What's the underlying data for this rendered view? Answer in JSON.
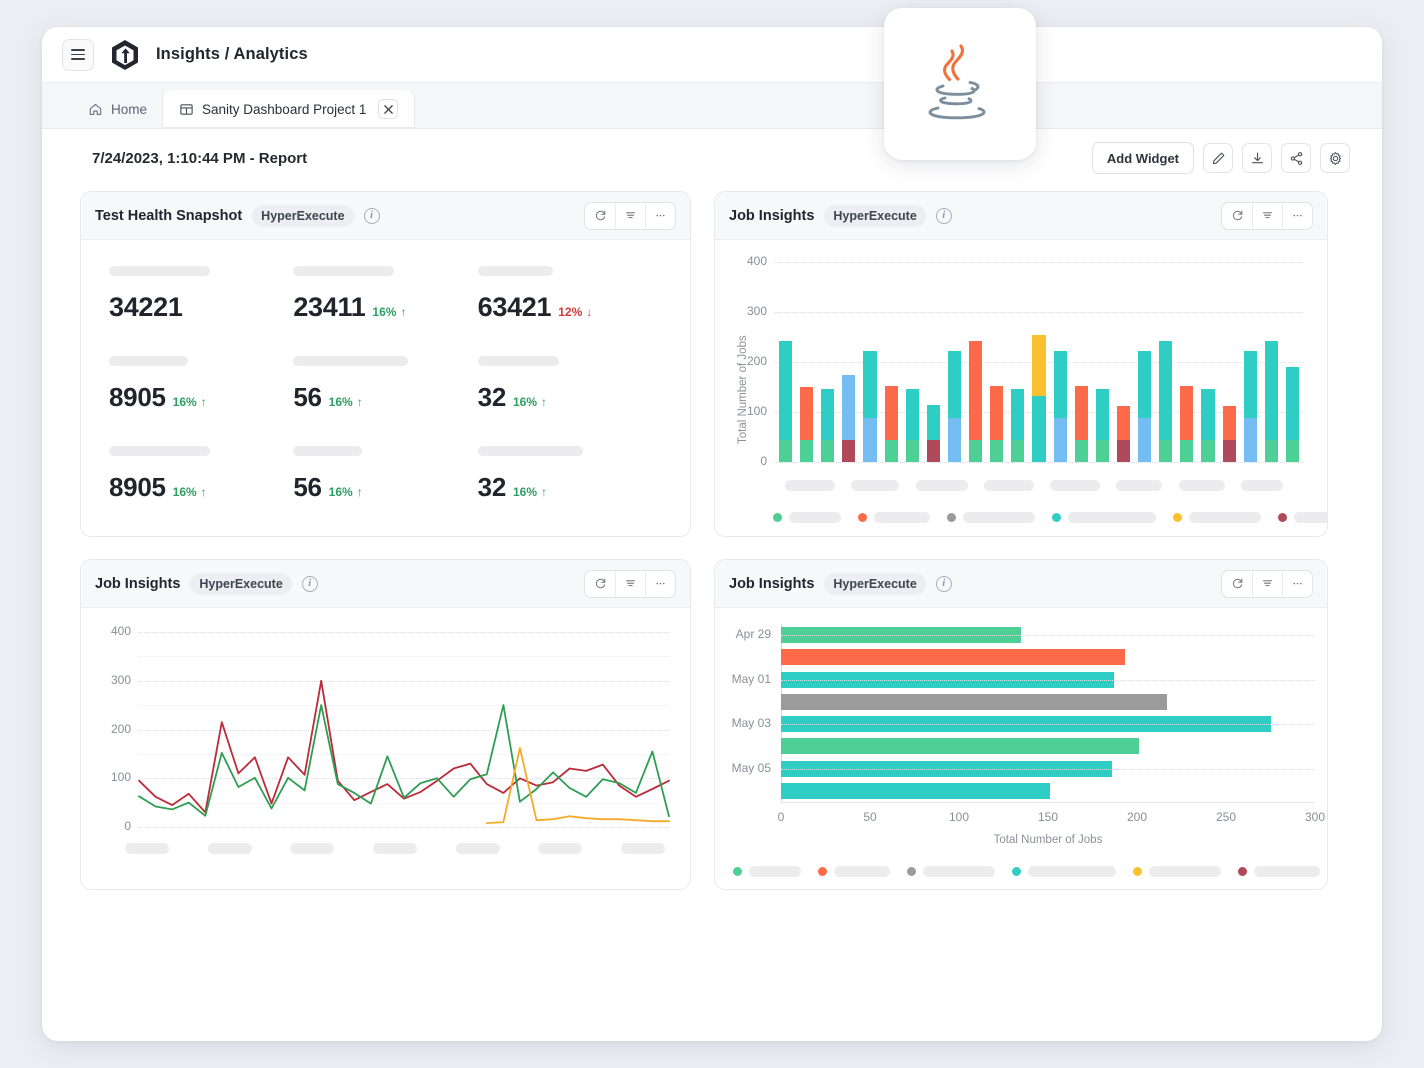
{
  "app": {
    "title": "Insights / Analytics",
    "menu_icon": "hamburger-icon",
    "logo_icon": "brand-hexagon-logo"
  },
  "tabs": [
    {
      "label": "Home",
      "icon": "home-icon",
      "active": false,
      "closable": false
    },
    {
      "label": "Sanity Dashboard Project 1",
      "icon": "dashboard-icon",
      "active": true,
      "closable": true
    }
  ],
  "report": {
    "title": "7/24/2023, 1:10:44 PM - Report",
    "toolbar": {
      "add_widget_label": "Add Widget",
      "edit_icon": "pencil-icon",
      "download_icon": "download-icon",
      "share_icon": "share-icon",
      "settings_icon": "gear-icon"
    }
  },
  "floating_icon": {
    "name": "java-logo",
    "label": "Java"
  },
  "card_actions": {
    "refresh_icon": "refresh-icon",
    "filter_icon": "filter-icon",
    "more_icon": "more-horizontal-icon"
  },
  "colors": {
    "teal": "#2ecec4",
    "green": "#4ecf95",
    "orange": "#fc6a4a",
    "blue": "#74bdf2",
    "maroon": "#b04a5a",
    "yellow": "#fbc02d",
    "gray": "#9b9b9b",
    "up": "#2e9e63",
    "down": "#d23b3b",
    "line_red": "#bc2b3a",
    "line_green": "#2e9e52",
    "line_amber": "#f5ab2a",
    "skeleton": "#ececee"
  },
  "cards": {
    "snapshot": {
      "title": "Test Health Snapshot",
      "badge": "HyperExecute",
      "info_icon": "info-icon",
      "rows": [
        [
          {
            "value": "34221",
            "delta": null,
            "dir": null
          },
          {
            "value": "23411",
            "delta": "16%",
            "dir": "up"
          },
          {
            "value": "63421",
            "delta": "12%",
            "dir": "down"
          }
        ],
        [
          {
            "value": "8905",
            "delta": "16%",
            "dir": "up"
          },
          {
            "value": "56",
            "delta": "16%",
            "dir": "up"
          },
          {
            "value": "32",
            "delta": "16%",
            "dir": "up"
          }
        ],
        [
          {
            "value": "8905",
            "delta": "16%",
            "dir": "up"
          },
          {
            "value": "56",
            "delta": "16%",
            "dir": "up"
          },
          {
            "value": "32",
            "delta": "16%",
            "dir": "up"
          }
        ]
      ]
    },
    "job_insights_bar": {
      "title": "Job Insights",
      "badge": "HyperExecute",
      "info_icon": "info-icon"
    },
    "job_insights_line": {
      "title": "Job Insights",
      "badge": "HyperExecute",
      "info_icon": "info-icon"
    },
    "job_insights_hbar": {
      "title": "Job Insights",
      "badge": "HyperExecute",
      "info_icon": "info-icon"
    }
  },
  "chart_data": [
    {
      "id": "stacked-bar",
      "type": "bar",
      "stacked": true,
      "title": "Job Insights",
      "xlabel": "",
      "ylabel": "Total Number of Jobs",
      "ylim": [
        0,
        400
      ],
      "yticks": [
        0,
        100,
        200,
        300,
        400
      ],
      "grid": true,
      "legend_position": "bottom",
      "legend": [
        {
          "color": "#4ecf95",
          "label": ""
        },
        {
          "color": "#fc6a4a",
          "label": ""
        },
        {
          "color": "#9b9b9b",
          "label": ""
        },
        {
          "color": "#2ecec4",
          "label": ""
        },
        {
          "color": "#fbc02d",
          "label": ""
        },
        {
          "color": "#b04a5a",
          "label": ""
        }
      ],
      "categories": [
        "",
        "",
        "",
        "",
        "",
        "",
        "",
        "",
        "",
        "",
        "",
        "",
        "",
        "",
        "",
        "",
        "",
        "",
        "",
        "",
        "",
        "",
        "",
        "",
        "",
        "",
        "",
        ""
      ],
      "bars": [
        {
          "segments": [
            {
              "color": "#4ecf95",
              "value": 44
            },
            {
              "color": "#2ecec4",
              "value": 198
            }
          ]
        },
        {
          "segments": [
            {
              "color": "#4ecf95",
              "value": 44
            },
            {
              "color": "#fc6a4a",
              "value": 107
            }
          ]
        },
        {
          "segments": [
            {
              "color": "#4ecf95",
              "value": 44
            },
            {
              "color": "#2ecec4",
              "value": 103
            }
          ]
        },
        {
          "segments": [
            {
              "color": "#b04a5a",
              "value": 44
            },
            {
              "color": "#74bdf2",
              "value": 130
            }
          ]
        },
        {
          "segments": [
            {
              "color": "#74bdf2",
              "value": 88
            },
            {
              "color": "#2ecec4",
              "value": 135
            }
          ]
        },
        {
          "segments": [
            {
              "color": "#4ecf95",
              "value": 44
            },
            {
              "color": "#fc6a4a",
              "value": 108
            }
          ]
        },
        {
          "segments": [
            {
              "color": "#4ecf95",
              "value": 44
            },
            {
              "color": "#2ecec4",
              "value": 103
            }
          ]
        },
        {
          "segments": [
            {
              "color": "#b04a5a",
              "value": 44
            },
            {
              "color": "#2ecec4",
              "value": 70
            }
          ]
        },
        {
          "segments": [
            {
              "color": "#74bdf2",
              "value": 88
            },
            {
              "color": "#2ecec4",
              "value": 135
            }
          ]
        },
        {
          "segments": [
            {
              "color": "#4ecf95",
              "value": 44
            },
            {
              "color": "#fc6a4a",
              "value": 199
            }
          ]
        },
        {
          "segments": [
            {
              "color": "#4ecf95",
              "value": 44
            },
            {
              "color": "#fc6a4a",
              "value": 108
            }
          ]
        },
        {
          "segments": [
            {
              "color": "#4ecf95",
              "value": 44
            },
            {
              "color": "#2ecec4",
              "value": 103
            }
          ]
        },
        {
          "segments": [
            {
              "color": "#2ecec4",
              "value": 133
            },
            {
              "color": "#fbc02d",
              "value": 122
            }
          ]
        },
        {
          "segments": [
            {
              "color": "#74bdf2",
              "value": 88
            },
            {
              "color": "#2ecec4",
              "value": 135
            }
          ]
        },
        {
          "segments": [
            {
              "color": "#4ecf95",
              "value": 44
            },
            {
              "color": "#fc6a4a",
              "value": 108
            }
          ]
        },
        {
          "segments": [
            {
              "color": "#4ecf95",
              "value": 44
            },
            {
              "color": "#2ecec4",
              "value": 103
            }
          ]
        },
        {
          "segments": [
            {
              "color": "#b04a5a",
              "value": 44
            },
            {
              "color": "#fc6a4a",
              "value": 69
            }
          ]
        },
        {
          "segments": [
            {
              "color": "#74bdf2",
              "value": 88
            },
            {
              "color": "#2ecec4",
              "value": 134
            }
          ]
        },
        {
          "segments": [
            {
              "color": "#4ecf95",
              "value": 44
            },
            {
              "color": "#2ecec4",
              "value": 199
            }
          ]
        },
        {
          "segments": [
            {
              "color": "#4ecf95",
              "value": 44
            },
            {
              "color": "#fc6a4a",
              "value": 109
            }
          ]
        },
        {
          "segments": [
            {
              "color": "#4ecf95",
              "value": 44
            },
            {
              "color": "#2ecec4",
              "value": 103
            }
          ]
        },
        {
          "segments": [
            {
              "color": "#b04a5a",
              "value": 44
            },
            {
              "color": "#fc6a4a",
              "value": 68
            }
          ]
        },
        {
          "segments": [
            {
              "color": "#74bdf2",
              "value": 88
            },
            {
              "color": "#2ecec4",
              "value": 135
            }
          ]
        },
        {
          "segments": [
            {
              "color": "#4ecf95",
              "value": 44
            },
            {
              "color": "#2ecec4",
              "value": 198
            }
          ]
        },
        {
          "segments": [
            {
              "color": "#4ecf95",
              "value": 44
            },
            {
              "color": "#2ecec4",
              "value": 146
            }
          ]
        }
      ]
    },
    {
      "id": "multi-line",
      "type": "line",
      "title": "Job Insights",
      "xlabel": "",
      "ylabel": "",
      "ylim": [
        0,
        400
      ],
      "yticks": [
        0,
        100,
        200,
        300,
        400
      ],
      "grid": true,
      "series": [
        {
          "name": "series-red",
          "color": "#bc2b3a",
          "values": [
            95,
            62,
            45,
            68,
            30,
            215,
            110,
            143,
            48,
            143,
            107,
            300,
            95,
            55,
            72,
            88,
            58,
            72,
            95,
            120,
            130,
            88,
            70,
            100,
            85,
            92,
            120,
            115,
            128,
            85,
            62,
            78,
            95
          ]
        },
        {
          "name": "series-green",
          "color": "#2e9e52",
          "values": [
            63,
            42,
            36,
            50,
            23,
            152,
            82,
            101,
            38,
            101,
            75,
            250,
            88,
            70,
            48,
            145,
            60,
            90,
            100,
            62,
            98,
            108,
            250,
            52,
            78,
            112,
            80,
            62,
            98,
            90,
            70,
            155,
            22
          ]
        },
        {
          "name": "series-amber",
          "color": "#f5ab2a",
          "values": [
            null,
            null,
            null,
            null,
            null,
            null,
            null,
            null,
            null,
            null,
            null,
            null,
            null,
            null,
            null,
            null,
            null,
            null,
            null,
            null,
            null,
            8,
            10,
            162,
            14,
            16,
            22,
            18,
            16,
            16,
            14,
            12,
            12
          ]
        }
      ],
      "legend_position": "none"
    },
    {
      "id": "horizontal-bar",
      "type": "bar",
      "orientation": "horizontal",
      "title": "Job Insights",
      "xlabel": "Total Number of Jobs",
      "ylabel": "",
      "xlim": [
        0,
        300
      ],
      "xticks": [
        0,
        50,
        100,
        150,
        200,
        250,
        300
      ],
      "ycategories": [
        "Apr 29",
        "May 01",
        "May 03",
        "May 05"
      ],
      "grid": true,
      "bars": [
        {
          "color": "#4ecf95",
          "value": 135
        },
        {
          "color": "#fc6a4a",
          "value": 193
        },
        {
          "color": "#2ecec4",
          "value": 187
        },
        {
          "color": "#9b9b9b",
          "value": 217
        },
        {
          "color": "#2ecec4",
          "value": 275
        },
        {
          "color": "#4ecf95",
          "value": 201
        },
        {
          "color": "#2ecec4",
          "value": 186
        },
        {
          "color": "#2ecec4",
          "value": 151
        }
      ],
      "legend_position": "bottom",
      "legend": [
        {
          "color": "#4ecf95",
          "label": ""
        },
        {
          "color": "#fc6a4a",
          "label": ""
        },
        {
          "color": "#9b9b9b",
          "label": ""
        },
        {
          "color": "#2ecec4",
          "label": ""
        },
        {
          "color": "#fbc02d",
          "label": ""
        },
        {
          "color": "#b04a5a",
          "label": ""
        }
      ]
    }
  ]
}
